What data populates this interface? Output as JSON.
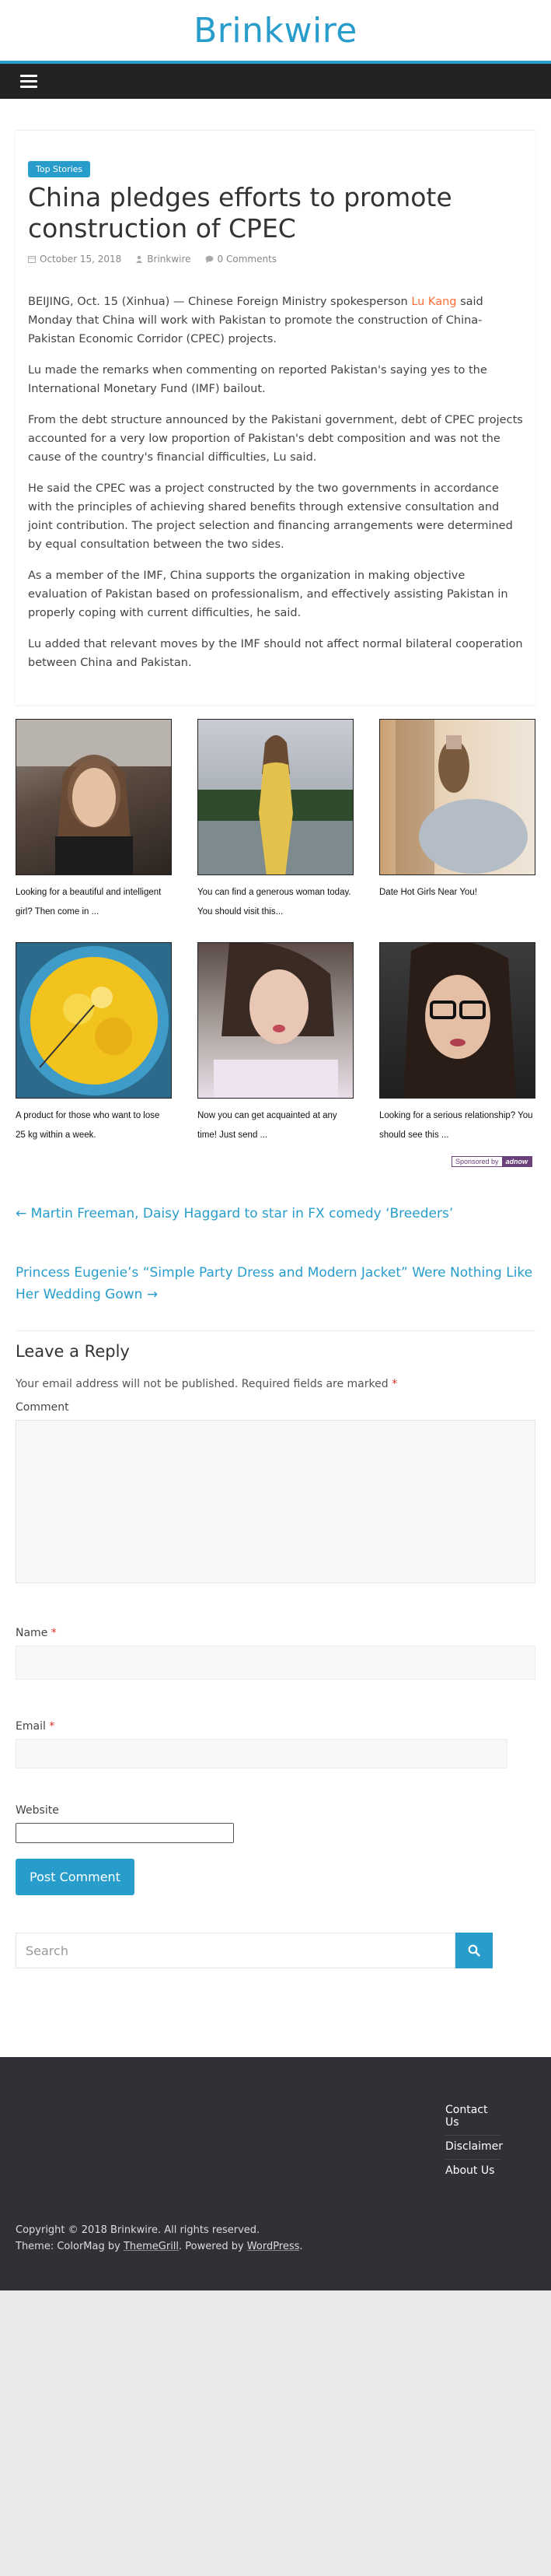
{
  "site": {
    "title": "Brinkwire"
  },
  "article": {
    "category": "Top Stories",
    "title": "China pledges efforts to promote construction of CPEC",
    "date": "October 15, 2018",
    "author": "Brinkwire",
    "comments": "0 Comments",
    "p1_before": "BEIJING, Oct. 15 (Xinhua) — Chinese Foreign Ministry spokesperson ",
    "p1_link": "Lu Kang",
    "p1_after": " said Monday that China will work with Pakistan to promote the construction of China-Pakistan Economic Corridor (CPEC) projects.",
    "p2": "Lu made the remarks when commenting on reported Pakistan's saying yes to the International Monetary Fund (IMF) bailout.",
    "p3": "From the debt structure announced by the Pakistani government, debt of CPEC projects accounted for a very low proportion of Pakistan's debt composition and was not the cause of the country's financial difficulties, Lu said.",
    "p4": "He said the CPEC was a project constructed by the two governments in accordance with the principles of achieving shared benefits through extensive consultation and joint contribution. The project selection and financing arrangements were determined by equal consultation between the two sides.",
    "p5": "As a member of the IMF, China supports the organization in making objective evaluation of Pakistan based on professionalism, and effectively assisting Pakistan in properly coping with current difficulties, he said.",
    "p6": "Lu added that relevant moves by the IMF should not affect normal bilateral cooperation between China and Pakistan."
  },
  "sponsored": {
    "items": [
      {
        "caption": "Looking for a beautiful and intelligent girl? Then come in ..."
      },
      {
        "caption": "You can find a generous woman today. You should visit this..."
      },
      {
        "caption": "Date Hot Girls Near You!"
      },
      {
        "caption": "A product for those who want to lose 25 kg within a week."
      },
      {
        "caption": "Now you can get acquainted at any time! Just send ..."
      },
      {
        "caption": "Looking for a serious relationship? You should see this ..."
      }
    ],
    "badge_label": "Sponsored by",
    "badge_brand": "adnow"
  },
  "post_nav": {
    "prev": "← Martin Freeman, Daisy Haggard to star in FX comedy ‘Breeders’",
    "next": "Princess Eugenie’s “Simple Party Dress and Modern Jacket” Were Nothing Like Her Wedding Gown →"
  },
  "reply": {
    "heading": "Leave a Reply",
    "note_before": "Your email address will not be published. Required fields are marked ",
    "note_star": "*",
    "comment_label": "Comment",
    "name_label": "Name",
    "email_label": "Email",
    "website_label": "Website",
    "required_star": "*",
    "submit_label": "Post Comment"
  },
  "search": {
    "placeholder": "Search"
  },
  "footer": {
    "links": [
      "Contact Us",
      "Disclaimer",
      "About Us"
    ],
    "copyright": "Copyright © 2018 Brinkwire. All rights reserved.",
    "theme_prefix": "Theme: ColorMag by ",
    "theme_link": "ThemeGrill",
    "powered_prefix": ". Powered by ",
    "powered_link": "WordPress",
    "powered_suffix": "."
  },
  "colors": {
    "accent": "#289dcc",
    "link_orange": "#ff6b33",
    "footer_bg": "#2f3136",
    "nav_bg": "#232323"
  }
}
